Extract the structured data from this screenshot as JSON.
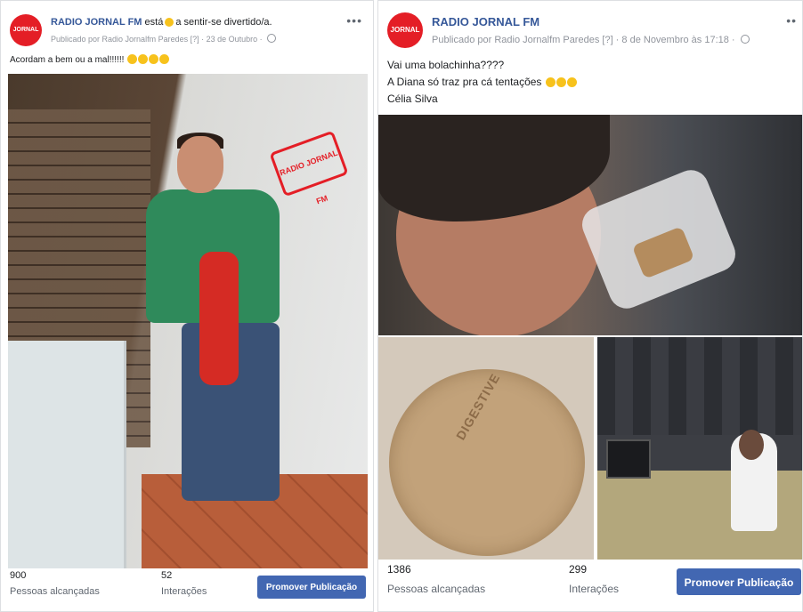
{
  "colors": {
    "brand_red": "#e41e26",
    "link_blue": "#365899",
    "button_blue": "#4267b2",
    "muted_gray": "#90949c"
  },
  "posts": [
    {
      "avatar_label": "JORNAL",
      "page_name": "RADIO JORNAL FM",
      "feeling_prefix": "está",
      "feeling_text": "a sentir-se divertido/a.",
      "published_by": "Publicado por Radio Jornalfm Paredes",
      "info_marker": "[?]",
      "date": "23 de Outubro",
      "privacy_icon": "globe-icon",
      "caption_lines": [
        "Acordam a bem ou a mal!!!!!!"
      ],
      "caption_emoji_count": 4,
      "photo_sign_text": "RADIO JORNAL FM",
      "stats": {
        "reach_value": "900",
        "reach_label": "Pessoas alcançadas",
        "interactions_value": "52",
        "interactions_label": "Interações"
      },
      "promote_label": "Promover Publicação",
      "menu_icon": "more-options-icon"
    },
    {
      "avatar_label": "JORNAL",
      "page_name": "RADIO JORNAL FM",
      "published_by": "Publicado por Radio Jornalfm Paredes",
      "info_marker": "[?]",
      "date": "8 de Novembro às 17:18",
      "privacy_icon": "globe-icon",
      "caption_lines": [
        "Vai uma bolachinha????",
        "A Diana só traz pra cá tentações",
        "Célia Silva"
      ],
      "caption_emoji_count": 3,
      "photo_biscuit_text": "DIGESTIVE",
      "stats": {
        "reach_value": "1386",
        "reach_label": "Pessoas alcançadas",
        "interactions_value": "299",
        "interactions_label": "Interações"
      },
      "promote_label": "Promover Publicação",
      "menu_icon": "more-options-icon"
    }
  ]
}
